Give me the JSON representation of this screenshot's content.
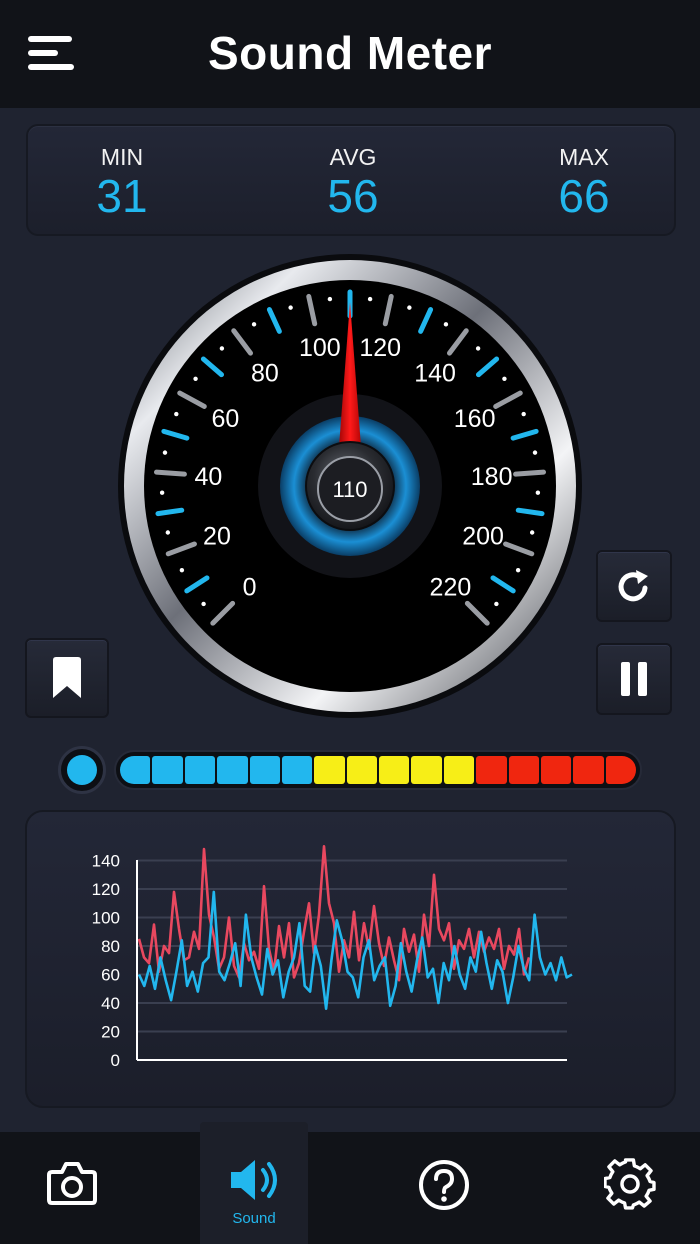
{
  "header": {
    "title": "Sound Meter"
  },
  "stats": {
    "min": {
      "label": "MIN",
      "value": "31"
    },
    "avg": {
      "label": "AVG",
      "value": "56"
    },
    "max": {
      "label": "MAX",
      "value": "66"
    }
  },
  "gauge": {
    "min": 0,
    "max": 220,
    "labels": [
      "0",
      "20",
      "40",
      "60",
      "80",
      "100",
      "120",
      "140",
      "160",
      "180",
      "200",
      "220"
    ],
    "needle_value": 110,
    "center_reading": "110"
  },
  "level_meter": {
    "segments": [
      "blue",
      "blue",
      "blue",
      "blue",
      "blue",
      "blue",
      "yellow",
      "yellow",
      "yellow",
      "yellow",
      "yellow",
      "red",
      "red",
      "red",
      "red",
      "red"
    ],
    "colors": {
      "blue": "#22b7ee",
      "yellow": "#f7ee17",
      "red": "#f0260f"
    }
  },
  "chart_data": {
    "type": "line",
    "ylim": [
      0,
      150
    ],
    "yticks": [
      "0",
      "20",
      "40",
      "60",
      "80",
      "100",
      "120",
      "140"
    ],
    "series": [
      {
        "color": "#e8485f",
        "values": [
          85,
          72,
          68,
          95,
          62,
          80,
          75,
          118,
          92,
          70,
          72,
          90,
          78,
          148,
          102,
          86,
          64,
          72,
          100,
          66,
          58,
          82,
          70,
          76,
          64,
          122,
          78,
          62,
          94,
          72,
          96,
          58,
          68,
          90,
          110,
          75,
          102,
          150,
          110,
          96,
          62,
          84,
          72,
          104,
          70,
          96,
          78,
          108,
          82,
          66,
          86,
          70,
          56,
          92,
          76,
          88,
          62,
          102,
          80,
          130,
          92,
          84,
          96,
          64,
          84,
          78,
          92,
          72,
          90,
          76,
          86,
          78,
          92,
          64,
          80,
          74,
          92,
          60,
          72
        ],
        "points": 72
      },
      {
        "color": "#22b7ee",
        "values": [
          60,
          52,
          66,
          50,
          72,
          56,
          42,
          62,
          84,
          52,
          62,
          48,
          68,
          72,
          118,
          62,
          56,
          68,
          82,
          52,
          102,
          72,
          58,
          46,
          78,
          60,
          70,
          44,
          62,
          72,
          96,
          52,
          48,
          80,
          66,
          36,
          70,
          98,
          84,
          62,
          58,
          44,
          72,
          84,
          56,
          66,
          72,
          38,
          52,
          82,
          62,
          48,
          70,
          86,
          58,
          64,
          40,
          68,
          56,
          80,
          60,
          50,
          72,
          62,
          90,
          68,
          50,
          70,
          62,
          40,
          58,
          80,
          64,
          56,
          102,
          72,
          60,
          68,
          56,
          72,
          58,
          60
        ],
        "points": 82
      }
    ]
  },
  "nav": {
    "items": [
      {
        "name": "camera",
        "label": ""
      },
      {
        "name": "sound",
        "label": "Sound"
      },
      {
        "name": "help",
        "label": ""
      },
      {
        "name": "settings",
        "label": ""
      }
    ]
  },
  "colors": {
    "accent": "#22b7ee",
    "needle": "#e00000"
  }
}
